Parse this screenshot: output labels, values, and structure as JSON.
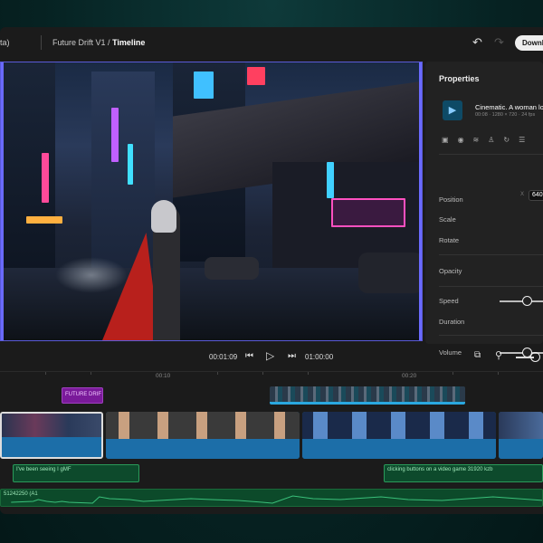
{
  "header": {
    "app_fragment": "ta)",
    "project": "Future Drift V1",
    "separator": "/",
    "page": "Timeline",
    "download_label": "Download"
  },
  "properties": {
    "title": "Properties",
    "clip": {
      "name": "Cinematic. A woman lo",
      "meta": "00:08 · 1280 × 720 · 24 fps"
    },
    "position_label": "Position",
    "x_label": "X",
    "x_value": "640",
    "scale_label": "Scale",
    "rotate_label": "Rotate",
    "opacity_label": "Opacity",
    "speed_label": "Speed",
    "duration_label": "Duration",
    "volume_label": "Volume"
  },
  "transport": {
    "current_time": "00:01:09",
    "total_time": "01:00:00"
  },
  "ruler": {
    "labels": [
      "00:10",
      "00:20"
    ]
  },
  "timeline": {
    "title_clip": "FUTURE DRIF",
    "audio_clip_1": "I've been seeing I gMF",
    "audio_clip_2": "clicking buttons on a video game 31920 kzb",
    "audio_track_2": "51242250 (A1"
  },
  "colors": {
    "accent": "#5a5ad8",
    "title_clip": "#7a1a9a",
    "video_track": "#1c6ea8",
    "audio_track": "#0d4a2c"
  }
}
